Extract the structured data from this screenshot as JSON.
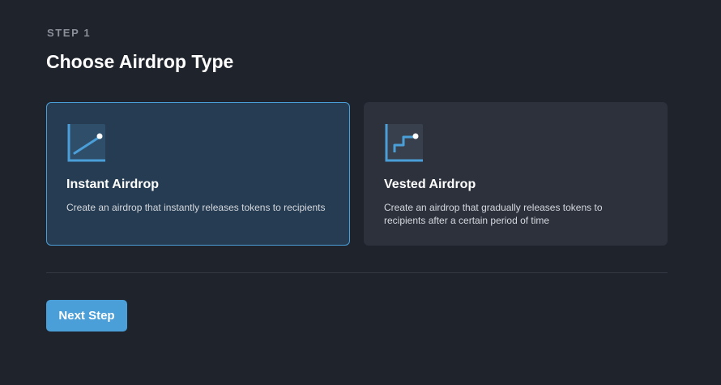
{
  "step": {
    "label": "STEP 1"
  },
  "page": {
    "title": "Choose Airdrop Type"
  },
  "cards": [
    {
      "id": "instant",
      "title": "Instant Airdrop",
      "description": "Create an airdrop that instantly releases tokens to recipients",
      "icon": "instant-chart-icon",
      "selected": true
    },
    {
      "id": "vested",
      "title": "Vested Airdrop",
      "description": "Create an airdrop that gradually releases tokens to recipients after a certain period of time",
      "icon": "vested-chart-icon",
      "selected": false
    }
  ],
  "actions": {
    "next_label": "Next Step"
  },
  "colors": {
    "background": "#1f232c",
    "accent": "#4a9fd8",
    "selected_card": "#253c52",
    "card": "#2c313c"
  }
}
